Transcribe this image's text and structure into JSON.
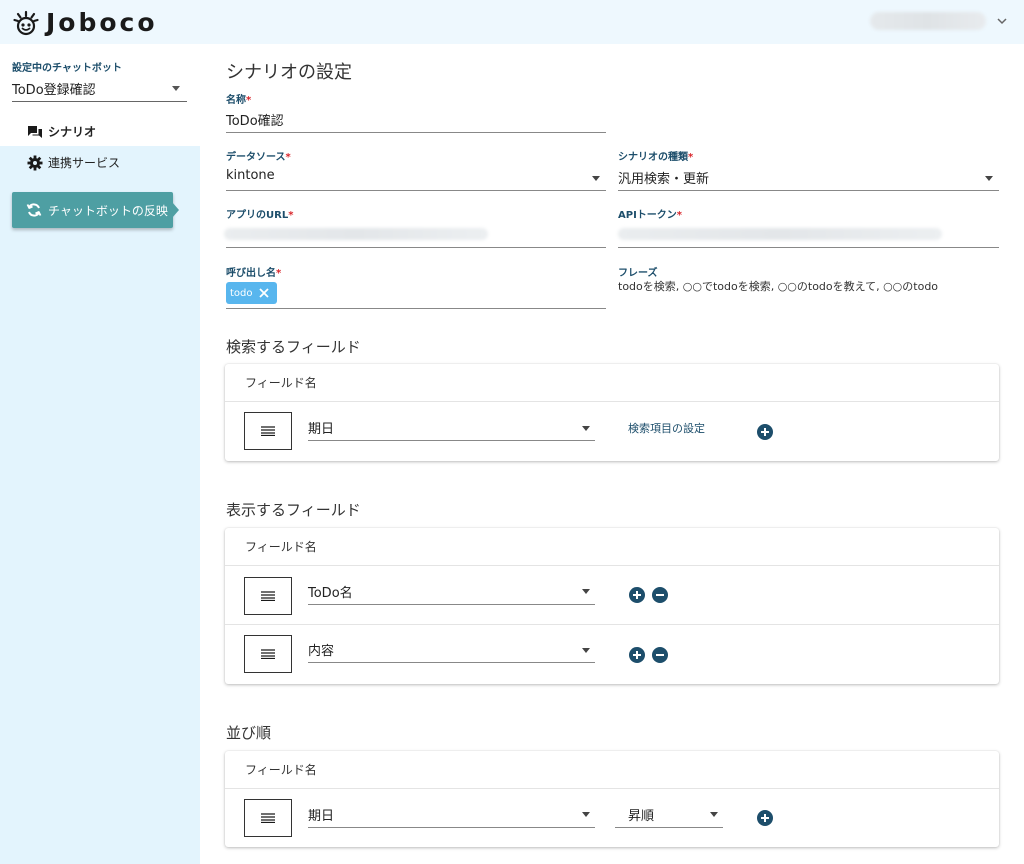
{
  "app": {
    "name": "Joboco"
  },
  "sidebar": {
    "bot_label": "設定中のチャットボット",
    "bot_value": "ToDo登録確認",
    "nav": [
      {
        "label": "シナリオ"
      },
      {
        "label": "連携サービス"
      }
    ],
    "reflect_button": "チャットボットの反映"
  },
  "main": {
    "title": "シナリオの設定",
    "fields": {
      "name": {
        "label": "名称",
        "value": "ToDo確認"
      },
      "datasource": {
        "label": "データソース",
        "value": "kintone"
      },
      "scenario_type": {
        "label": "シナリオの種類",
        "value": "汎用検索・更新"
      },
      "app_url": {
        "label": "アプリのURL"
      },
      "api_token": {
        "label": "APIトークン"
      },
      "call_name": {
        "label": "呼び出し名",
        "chip": "todo"
      },
      "phrases": {
        "label": "フレーズ",
        "value": "todoを検索, ○○でtodoを検索, ○○のtodoを教えて, ○○のtodo"
      }
    },
    "search_section": {
      "title": "検索するフィールド",
      "header": "フィールド名",
      "rows": [
        {
          "value": "期日",
          "link": "検索項目の設定"
        }
      ]
    },
    "display_section": {
      "title": "表示するフィールド",
      "header": "フィールド名",
      "rows": [
        {
          "value": "ToDo名"
        },
        {
          "value": "内容"
        }
      ]
    },
    "order_section": {
      "title": "並び順",
      "header": "フィールド名",
      "rows": [
        {
          "value": "期日",
          "order": "昇順"
        }
      ]
    }
  },
  "colors": {
    "accent": "#1d4e6b",
    "button": "#4e9fa3",
    "chip": "#58b6ee",
    "required": "#d9262c",
    "sidebar_bg": "#e3f4fd"
  },
  "icons": [
    "logo-icon",
    "chevron-down-icon",
    "chat-icon",
    "gear-icon",
    "refresh-icon",
    "close-icon",
    "drag-handle-icon",
    "plus-circle-icon",
    "minus-circle-icon"
  ]
}
